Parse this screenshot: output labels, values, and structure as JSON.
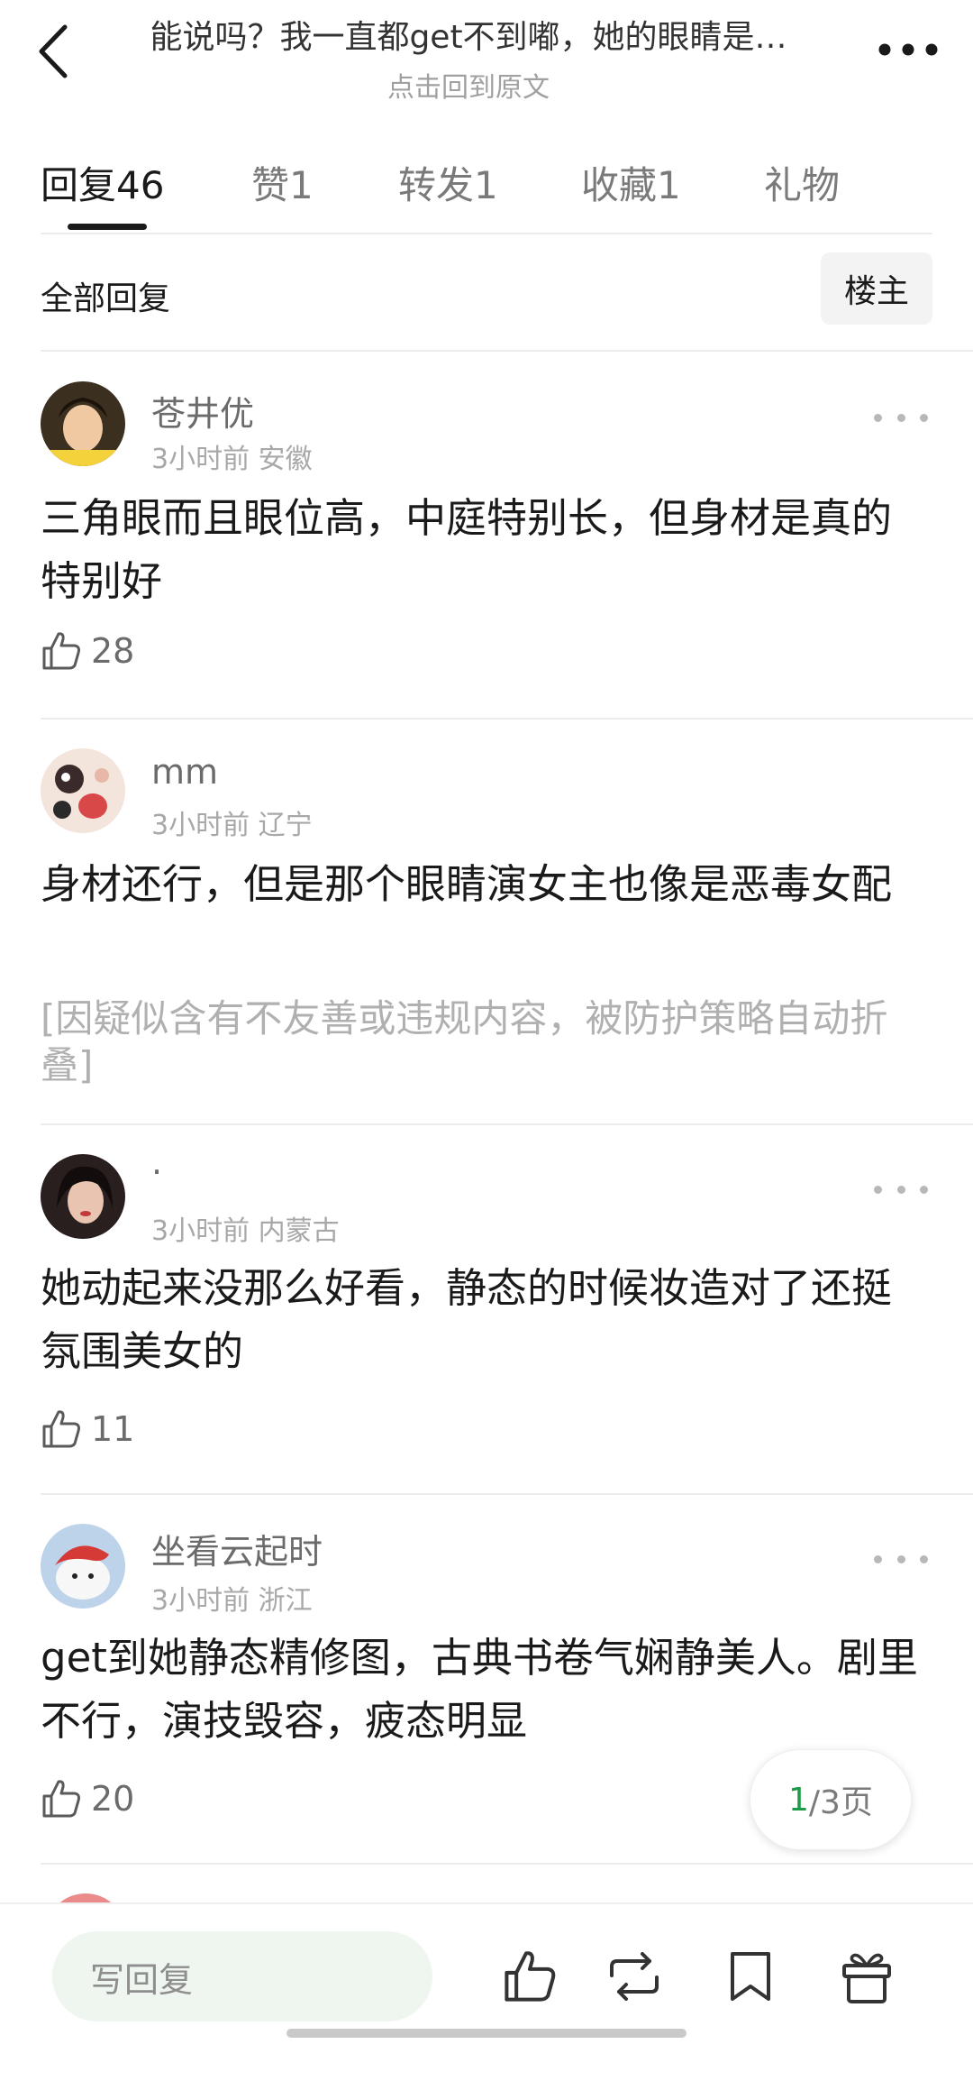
{
  "header": {
    "title": "能说吗？我一直都get不到嘟，她的眼睛是…",
    "subtitle": "点击回到原文",
    "back_icon": "chevron-left-icon",
    "more_icon": "more-horizontal-icon"
  },
  "tabs": [
    {
      "label": "回复",
      "count": "46"
    },
    {
      "label": "赞",
      "count": "1"
    },
    {
      "label": "转发",
      "count": "1"
    },
    {
      "label": "收藏",
      "count": "1"
    },
    {
      "label": "礼物",
      "count": ""
    }
  ],
  "filter": {
    "label": "全部回复",
    "owner_button": "楼主"
  },
  "comments": [
    {
      "name": "苍井优",
      "time": "3小时前",
      "location": "安徽",
      "text": "三角眼而且眼位高，中庭特别长，但身材是真的特别好",
      "likes": "28",
      "avatar_color": "#3b3020"
    },
    {
      "name": "mm",
      "time": "3小时前",
      "location": "辽宁",
      "text": "身材还行，但是那个眼睛演女主也像是恶毒女配",
      "folded_notice": "[因疑似含有不友善或违规内容，被防护策略自动折叠]",
      "avatar_color": "#f3e4dc"
    },
    {
      "name": "·",
      "time": "3小时前",
      "location": "内蒙古",
      "text": "她动起来没那么好看，静态的时候妆造对了还挺氛围美女的",
      "likes": "11",
      "avatar_color": "#2a1f1f"
    },
    {
      "name": "坐看云起时",
      "time": "3小时前",
      "location": "浙江",
      "text": "get到她静态精修图，古典书卷气娴静美人。剧里不行，演技毁容，疲态明显",
      "likes": "20",
      "avatar_color": "#bcd3ea"
    }
  ],
  "pagination": {
    "current": "1",
    "rest": "/3页"
  },
  "bottom_bar": {
    "reply_placeholder": "写回复",
    "icons": [
      "thumbs-up-icon",
      "repost-icon",
      "bookmark-icon",
      "gift-icon"
    ]
  },
  "colors": {
    "accent_green": "#1e9b48",
    "reply_bg": "#eef6ef"
  }
}
